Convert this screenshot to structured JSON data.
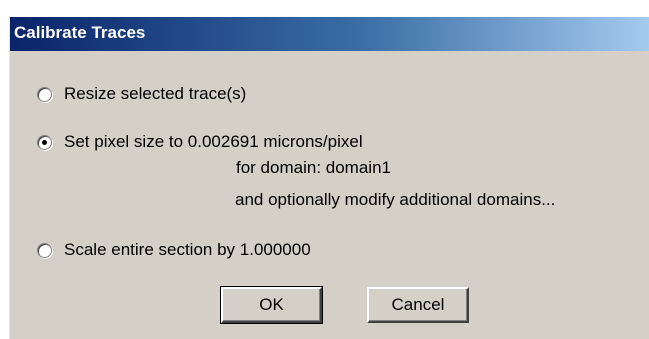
{
  "dialog": {
    "title": "Calibrate Traces"
  },
  "options": [
    {
      "label": "Resize selected trace(s)",
      "selected": false
    },
    {
      "label": "Set pixel size to 0.002691 microns/pixel",
      "selected": true
    },
    {
      "label": "Scale entire section by 1.000000",
      "selected": false
    }
  ],
  "pixel_option_details": {
    "domain_line": "for domain: domain1",
    "modify_line": "and optionally modify additional domains..."
  },
  "buttons": {
    "ok_label": "OK",
    "cancel_label": "Cancel"
  },
  "colors": {
    "titlebar_start": "#0a246a",
    "titlebar_end": "#a6caf0",
    "dialog_bg": "#d4d0c8"
  }
}
